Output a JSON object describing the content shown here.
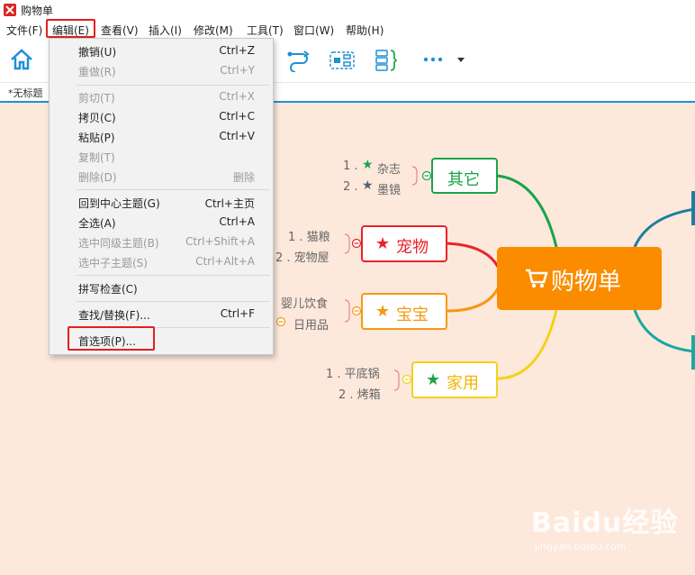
{
  "app": {
    "title": "购物单"
  },
  "menubar": {
    "items": [
      "文件(F)",
      "编辑(E)",
      "查看(V)",
      "插入(I)",
      "修改(M)",
      "工具(T)",
      "窗口(W)",
      "帮助(H)"
    ]
  },
  "tab": {
    "label": "*无标题"
  },
  "edit_menu": {
    "items": [
      {
        "label": "撤销(U)",
        "shortcut": "Ctrl+Z"
      },
      {
        "label": "重做(R)",
        "shortcut": "Ctrl+Y"
      },
      {
        "label": "剪切(T)",
        "shortcut": "Ctrl+X"
      },
      {
        "label": "拷贝(C)",
        "shortcut": "Ctrl+C"
      },
      {
        "label": "粘贴(P)",
        "shortcut": "Ctrl+V"
      },
      {
        "label": "复制(T)",
        "shortcut": ""
      },
      {
        "label": "删除(D)",
        "shortcut": "删除"
      },
      {
        "label": "回到中心主题(G)",
        "shortcut": "Ctrl+主页"
      },
      {
        "label": "全选(A)",
        "shortcut": "Ctrl+A"
      },
      {
        "label": "选中同级主题(B)",
        "shortcut": "Ctrl+Shift+A"
      },
      {
        "label": "选中子主题(S)",
        "shortcut": "Ctrl+Alt+A"
      },
      {
        "label": "拼写检查(C)",
        "shortcut": ""
      },
      {
        "label": "查找/替换(F)...",
        "shortcut": "Ctrl+F"
      },
      {
        "label": "首选项(P)...",
        "shortcut": ""
      }
    ]
  },
  "mindmap": {
    "central": "购物单",
    "branches": [
      {
        "label": "其它",
        "color": "#1aa34a",
        "leaves": [
          "1 .",
          "杂志",
          "2 .",
          "墨镜"
        ]
      },
      {
        "label": "宠物",
        "color": "#e8232a",
        "leaves": [
          "1 . 猫粮",
          "2 . 宠物屋"
        ]
      },
      {
        "label": "宝宝",
        "color": "#f39a12",
        "leaves": [
          "婴儿饮食",
          "日用品"
        ]
      },
      {
        "label": "家用",
        "color": "#f2d21c",
        "leaves": [
          "1 . 平底锅",
          "2 . 烤箱"
        ]
      }
    ]
  },
  "watermark": {
    "brand": "Baidu经验",
    "url": "jingyan.baidu.com"
  },
  "colors": {
    "central_bg": "#fb8c00",
    "canvas_bg": "#fde8dc",
    "highlight": "#e02020"
  }
}
